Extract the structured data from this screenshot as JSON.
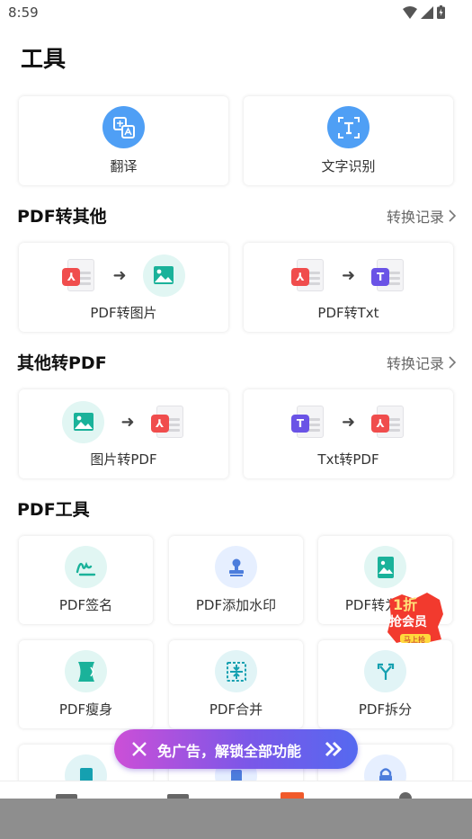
{
  "status": {
    "time": "8:59"
  },
  "page_title": "工具",
  "top_tools": [
    {
      "label": "翻译",
      "icon": "translate-icon"
    },
    {
      "label": "文字识别",
      "icon": "text-recognition-icon"
    }
  ],
  "sections": {
    "pdf_to_other": {
      "title": "PDF转其他",
      "link": "转换记录"
    },
    "other_to_pdf": {
      "title": "其他转PDF",
      "link": "转换记录"
    },
    "pdf_tools": {
      "title": "PDF工具"
    }
  },
  "pdf_to_other": [
    {
      "label": "PDF转图片"
    },
    {
      "label": "PDF转Txt"
    }
  ],
  "other_to_pdf": [
    {
      "label": "图片转PDF"
    },
    {
      "label": "Txt转PDF"
    }
  ],
  "pdf_tools": [
    {
      "label": "PDF签名",
      "icon": "signature-icon"
    },
    {
      "label": "PDF添加水印",
      "icon": "stamp-icon"
    },
    {
      "label": "PDF转为长图",
      "icon": "long-image-icon"
    },
    {
      "label": "PDF瘦身",
      "icon": "compress-icon"
    },
    {
      "label": "PDF合并",
      "icon": "merge-icon"
    },
    {
      "label": "PDF拆分",
      "icon": "split-icon"
    }
  ],
  "promo": {
    "text": "免广告，解锁全部功能"
  },
  "badge": {
    "line1": "1折",
    "line2": "抢会员",
    "line3": "马上抢"
  },
  "colors": {
    "blue": "#4f9ff5",
    "teal_bg": "#e1f6f3",
    "teal": "#1ab29a",
    "red": "#f04d4d",
    "purple": "#6a53e6",
    "blue_bg": "#e6efff",
    "blue_icon": "#4c7ddc",
    "cyan_bg": "#e1f4f6",
    "cyan": "#15a0b0"
  }
}
